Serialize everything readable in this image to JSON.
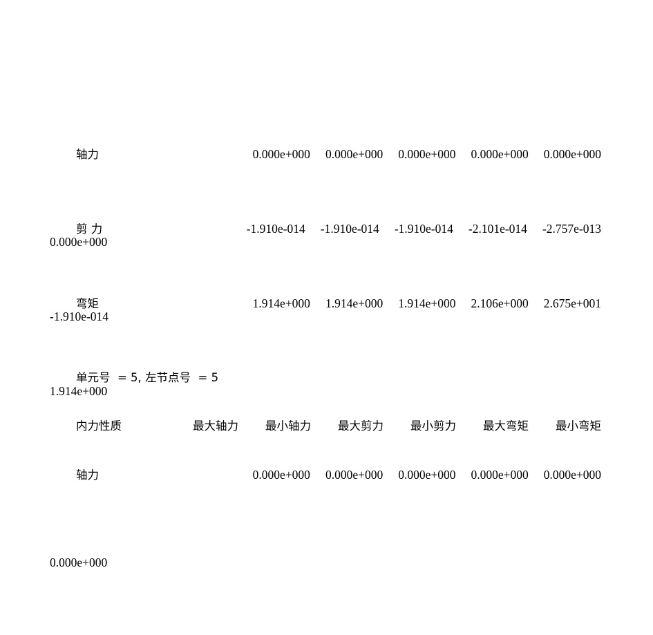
{
  "document": {
    "type": "structural-analysis-internal-force-report",
    "background_color": "#ffffff",
    "text_color": "#000000"
  },
  "columns": {
    "property_header": "内力性质",
    "headers": [
      "最大轴力",
      "最小轴力",
      "最大剪力",
      "最小剪力",
      "最大弯矩",
      "最小弯矩"
    ]
  },
  "element_info": {
    "line": "单元号  = 5, 左节点号  = 5"
  },
  "rows": {
    "axial_first": {
      "label": "轴力",
      "values": [
        "0.000e+000",
        "0.000e+000",
        "0.000e+000",
        "0.000e+000",
        "0.000e+000"
      ],
      "wrapped_value": "0.000e+000"
    },
    "shear_first": {
      "label": "剪 力",
      "values": [
        "-1.910e-014",
        "-1.910e-014",
        "-1.910e-014",
        "-2.101e-014",
        "-2.757e-013"
      ],
      "wrapped_value": "-1.910e-014"
    },
    "moment_first": {
      "label": "弯矩",
      "values": [
        "1.914e+000",
        "1.914e+000",
        "1.914e+000",
        "2.106e+000",
        "2.675e+001"
      ],
      "wrapped_value": "1.914e+000"
    },
    "axial_second": {
      "label": "轴力",
      "values": [
        "0.000e+000",
        "0.000e+000",
        "0.000e+000",
        "0.000e+000",
        "0.000e+000"
      ],
      "wrapped_value": "0.000e+000"
    }
  }
}
